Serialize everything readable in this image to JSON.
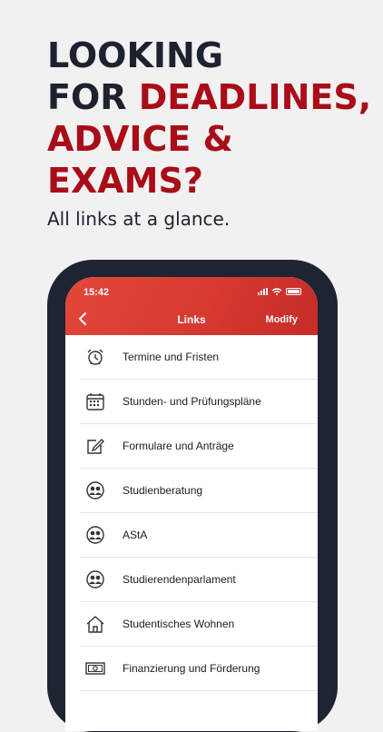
{
  "headline": {
    "line1": "LOOKING",
    "line2_plain": "FOR ",
    "line2_red": "DEADLINES,",
    "line3": "ADVICE &",
    "line4": "EXAMS?"
  },
  "subline": "All links at a glance.",
  "status_bar": {
    "time": "15:42"
  },
  "navbar": {
    "title": "Links",
    "modify_label": "Modify"
  },
  "links": [
    {
      "label": "Termine und Fristen",
      "icon": "alarm-clock-icon"
    },
    {
      "label": "Stunden- und Prüfungspläne",
      "icon": "calendar-icon"
    },
    {
      "label": "Formulare und Anträge",
      "icon": "edit-form-icon"
    },
    {
      "label": "Studienberatung",
      "icon": "people-icon"
    },
    {
      "label": "AStA",
      "icon": "people-icon"
    },
    {
      "label": "Studierendenparlament",
      "icon": "people-icon"
    },
    {
      "label": "Studentisches Wohnen",
      "icon": "house-icon"
    },
    {
      "label": "Finanzierung und Förderung",
      "icon": "banknote-icon"
    }
  ],
  "colors": {
    "headline_dark": "#1e2230",
    "headline_red": "#a90d18",
    "navbar_red": "#d63a30",
    "phone_frame": "#1f2433"
  }
}
